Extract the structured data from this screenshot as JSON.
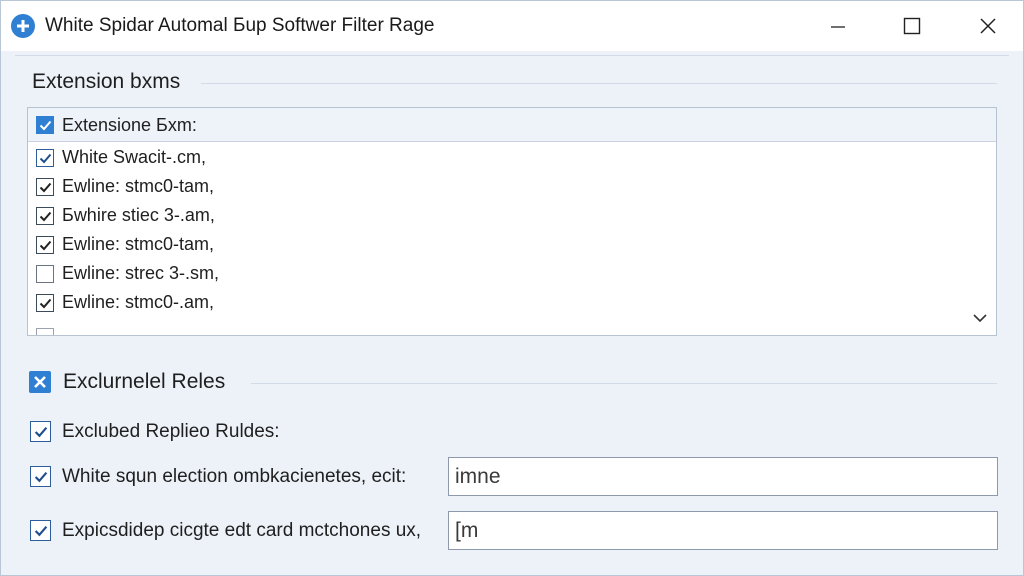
{
  "window": {
    "title": "White Spidar Automal Бup Softwer Filter Rage"
  },
  "extension": {
    "section_title": "Extension bxms",
    "header_label": "Extensione Бxm:",
    "header_checked": true,
    "items": [
      {
        "label": "White Swacit-.cm,",
        "checked": true
      },
      {
        "label": "Ewline: stmc0-tam,",
        "checked": true
      },
      {
        "label": "Бwhire stiec 3-.am,",
        "checked": true
      },
      {
        "label": "Ewline: stmc0-tam,",
        "checked": true
      },
      {
        "label": "Ewline: strec 3-.sm,",
        "checked": false
      },
      {
        "label": "Ewline: stmc0-.am,",
        "checked": true
      }
    ]
  },
  "excluded": {
    "section_title": "Exclurnelel Reles",
    "rules_label": "Exclubed Replieo Ruldes:",
    "selection_label": "White squn election ombkacienetes, ecit:",
    "selection_value": "imne",
    "expression_label": "Expicsdidep cicgte edt card mctchones ux,",
    "expression_value": "[m"
  },
  "icons": {
    "app": "plus-circle-icon",
    "minimize": "minimize-icon",
    "maximize": "maximize-icon",
    "close": "close-icon",
    "dropdown": "chevron-down-icon"
  },
  "colors": {
    "accent": "#2f7fd2",
    "background": "#edf2f9"
  }
}
